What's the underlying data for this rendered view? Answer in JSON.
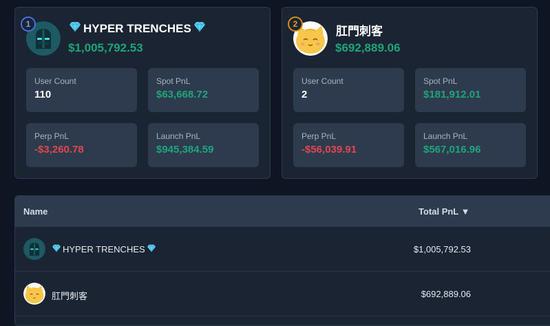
{
  "cards": [
    {
      "rank": "1",
      "name": "HYPER TRENCHES",
      "total_pnl": "$1,005,792.53",
      "stats": {
        "user_count": {
          "label": "User Count",
          "value": "110"
        },
        "spot_pnl": {
          "label": "Spot PnL",
          "value": "$63,668.72"
        },
        "perp_pnl": {
          "label": "Perp PnL",
          "value": "-$3,260.78"
        },
        "launch_pnl": {
          "label": "Launch PnL",
          "value": "$945,384.59"
        }
      }
    },
    {
      "rank": "2",
      "name": "肛門刺客",
      "total_pnl": "$692,889.06",
      "stats": {
        "user_count": {
          "label": "User Count",
          "value": "2"
        },
        "spot_pnl": {
          "label": "Spot PnL",
          "value": "$181,912.01"
        },
        "perp_pnl": {
          "label": "Perp PnL",
          "value": "-$56,039.91"
        },
        "launch_pnl": {
          "label": "Launch PnL",
          "value": "$567,016.96"
        }
      }
    }
  ],
  "table": {
    "headers": {
      "name": "Name",
      "total_pnl": "Total PnL ▼"
    },
    "rows": [
      {
        "name": "HYPER TRENCHES",
        "total_pnl": "$1,005,792.53"
      },
      {
        "name": "肛門刺客",
        "total_pnl": "$692,889.06"
      }
    ]
  },
  "colors": {
    "positive": "#1fa57a",
    "negative": "#e0474c",
    "rank_1": "#4a6fe0",
    "rank_2": "#d88a1a"
  },
  "icons": [
    "diamond-icon",
    "knight-helmet-avatar",
    "cat-avatar",
    "sort-desc-icon"
  ]
}
